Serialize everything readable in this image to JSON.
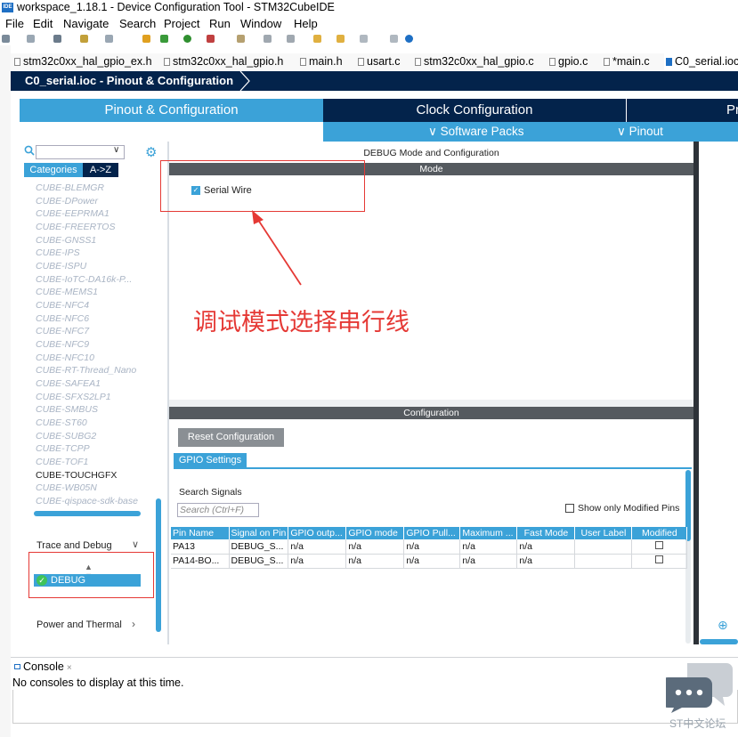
{
  "window": {
    "title": "workspace_1.18.1 - Device Configuration Tool - STM32CubeIDE",
    "icon_label": "IDE"
  },
  "menu": [
    "File",
    "Edit",
    "Navigate",
    "Search",
    "Project",
    "Run",
    "Window",
    "Help"
  ],
  "editor_tabs": [
    "stm32c0xx_hal_gpio_ex.h",
    "stm32c0xx_hal_gpio.h",
    "main.h",
    "usart.c",
    "stm32c0xx_hal_gpio.c",
    "gpio.c",
    "*main.c",
    "C0_serial.ioc"
  ],
  "breadcrumb": "C0_serial.ioc - Pinout & Configuration",
  "main_tabs": {
    "pinout": "Pinout & Configuration",
    "clock": "Clock Configuration",
    "project": "Pr"
  },
  "sub_menu": {
    "software_packs": "Software Packs",
    "pinout": "Pinout"
  },
  "left_panel": {
    "categories_btn": "Categories",
    "az_btn": "A->Z",
    "items": [
      "CUBE-BLEMGR",
      "CUBE-DPower",
      "CUBE-EEPRMA1",
      "CUBE-FREERTOS",
      "CUBE-GNSS1",
      "CUBE-IPS",
      "CUBE-ISPU",
      "CUBE-IoTC-DA16k-P...",
      "CUBE-MEMS1",
      "CUBE-NFC4",
      "CUBE-NFC6",
      "CUBE-NFC7",
      "CUBE-NFC9",
      "CUBE-NFC10",
      "CUBE-RT-Thread_Nano",
      "CUBE-SAFEA1",
      "CUBE-SFXS2LP1",
      "CUBE-SMBUS",
      "CUBE-ST60",
      "CUBE-SUBG2",
      "CUBE-TCPP",
      "CUBE-TOF1",
      "CUBE-TOUCHGFX",
      "CUBE-WB05N",
      "CUBE-qispace-sdk-base"
    ],
    "trace_debug": "Trace and Debug",
    "debug_item": "DEBUG",
    "power_thermal": "Power and Thermal"
  },
  "mode": {
    "title": "DEBUG Mode and Configuration",
    "section": "Mode",
    "serial_wire_label": "Serial Wire",
    "serial_wire_checked": true
  },
  "annotation": "调试模式选择串行线",
  "config": {
    "section": "Configuration",
    "reset_button": "Reset Configuration",
    "gpio_tab": "GPIO Settings",
    "search_signals_label": "Search Signals",
    "search_placeholder": "Search (Ctrl+F)",
    "show_modified_label": "Show only Modified Pins",
    "table_headers": [
      "Pin Name",
      "Signal on Pin",
      "GPIO outp...",
      "GPIO mode",
      "GPIO Pull...",
      "Maximum ...",
      "Fast Mode",
      "User Label",
      "Modified"
    ],
    "rows": [
      [
        "PA13",
        "DEBUG_S...",
        "n/a",
        "n/a",
        "n/a",
        "n/a",
        "n/a",
        "",
        ""
      ],
      [
        "PA14-BO...",
        "DEBUG_S...",
        "n/a",
        "n/a",
        "n/a",
        "n/a",
        "n/a",
        "",
        ""
      ]
    ]
  },
  "console": {
    "tab": "Console",
    "message": "No consoles to display at this time."
  },
  "watermark": "ST中文论坛",
  "colors": {
    "accent": "#3ba2d8",
    "navy": "#03234b",
    "annotation_red": "#e53935",
    "section_bar": "#555a5f"
  }
}
